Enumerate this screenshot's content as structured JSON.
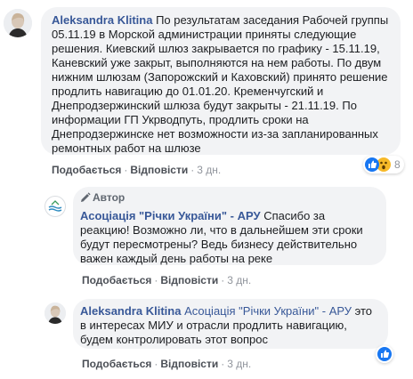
{
  "comments": [
    {
      "author": "Aleksandra Klitina",
      "text": "По результатам заседания Рабочей группы 05.11.19 в Морской администрации приняты следующие решения. Киевский шлюз закрывается по графику - 15.11.19, Каневский уже закрыт, выполняются на нем работы. По двум нижним шлюзам (Запорожский и Каховский) принято решение продлить навигацию до 01.01.20. Кременчугский и Днепродзержинский шлюза будут закрыты - 21.11.19. По информации ГП Укрводпуть, продлить сроки на Днепродзержинске нет возможности из-за запланированных ремонтных работ на шлюзе",
      "like_label": "Подобається",
      "reply_label": "Відповісти",
      "time": "3 дн.",
      "reactions_count": "8"
    },
    {
      "author_badge": "Автор",
      "author": "Асоціація \"Річки України\" - АРУ",
      "text": "Спасибо за реакцию! Возможно ли, что в дальнейшем эти сроки будут пересмотрены? Ведь бизнесу действительно важен каждый день работы на реке",
      "like_label": "Подобається",
      "reply_label": "Відповісти",
      "time": "3 дн."
    },
    {
      "author": "Aleksandra Klitina",
      "mention": "Асоціація \"Річки України\" - АРУ",
      "text": "это в интересах МИУ и отрасли продлить навигацию, будем контролировать этот вопрос",
      "like_label": "Подобається",
      "reply_label": "Відповісти",
      "time": "3 дн.",
      "reactions_count": ""
    }
  ],
  "colors": {
    "link_blue": "#385898",
    "bubble_bg": "#f2f3f5",
    "like_blue": "#1877f2",
    "wow_yellow": "#f7b928",
    "meta_gray": "#90949c"
  }
}
